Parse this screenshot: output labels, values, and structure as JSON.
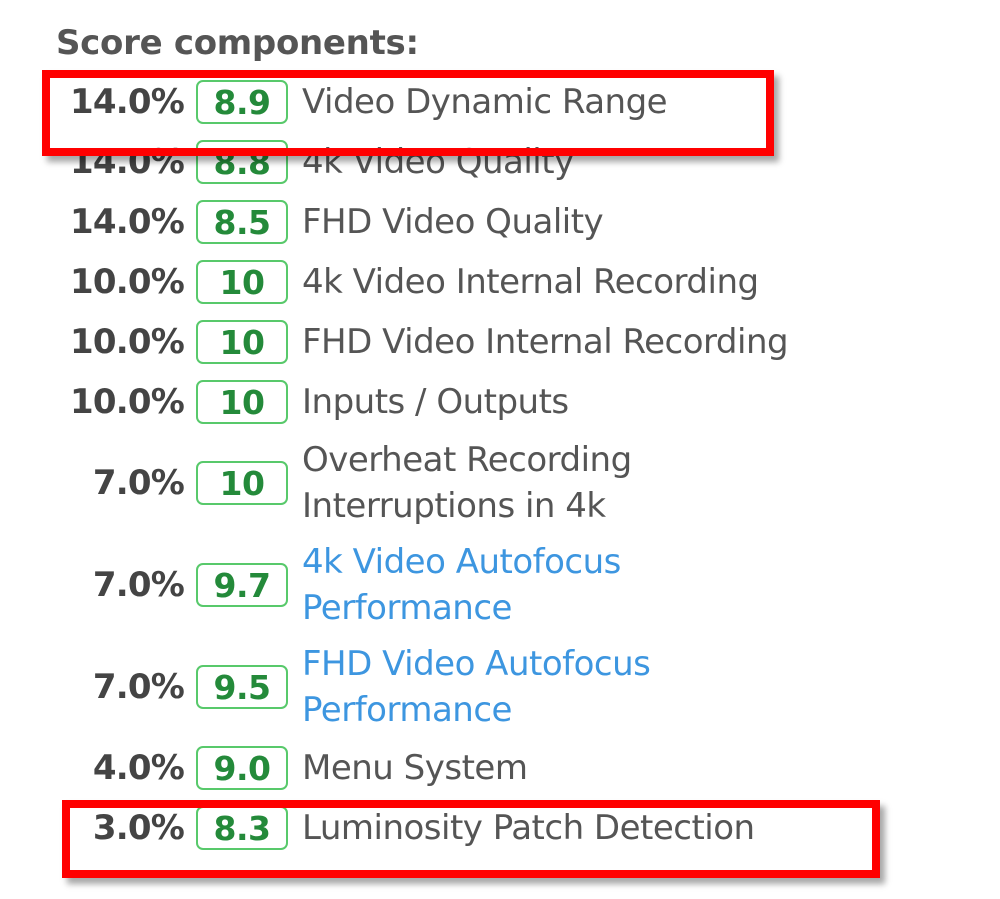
{
  "section": {
    "title": "Score components:"
  },
  "colors": {
    "highlight": "#ff0000",
    "score_border": "#58c96b",
    "score_text": "#248a3a",
    "link": "#3d96e0",
    "text": "#555555"
  },
  "components": [
    {
      "weight": "14.0%",
      "score": "8.9",
      "label": "Video Dynamic Range",
      "link": false,
      "highlighted": true
    },
    {
      "weight": "14.0%",
      "score": "8.8",
      "label": "4k Video Quality",
      "link": false,
      "highlighted": false
    },
    {
      "weight": "14.0%",
      "score": "8.5",
      "label": "FHD Video Quality",
      "link": false,
      "highlighted": false
    },
    {
      "weight": "10.0%",
      "score": "10",
      "label": "4k Video Internal Recording",
      "link": false,
      "highlighted": false
    },
    {
      "weight": "10.0%",
      "score": "10",
      "label": "FHD Video Internal Recording",
      "link": false,
      "highlighted": false
    },
    {
      "weight": "10.0%",
      "score": "10",
      "label": "Inputs / Outputs",
      "link": false,
      "highlighted": false
    },
    {
      "weight": "7.0%",
      "score": "10",
      "label_lines": [
        "Overheat Recording",
        "Interruptions in 4k"
      ],
      "link": false,
      "highlighted": false
    },
    {
      "weight": "7.0%",
      "score": "9.7",
      "label_lines": [
        "4k Video Autofocus",
        "Performance"
      ],
      "link": true,
      "highlighted": false
    },
    {
      "weight": "7.0%",
      "score": "9.5",
      "label_lines": [
        "FHD Video Autofocus",
        "Performance"
      ],
      "link": true,
      "highlighted": false
    },
    {
      "weight": "4.0%",
      "score": "9.0",
      "label": "Menu System",
      "link": false,
      "highlighted": false
    },
    {
      "weight": "3.0%",
      "score": "8.3",
      "label": "Luminosity Patch Detection",
      "link": false,
      "highlighted": true
    }
  ]
}
